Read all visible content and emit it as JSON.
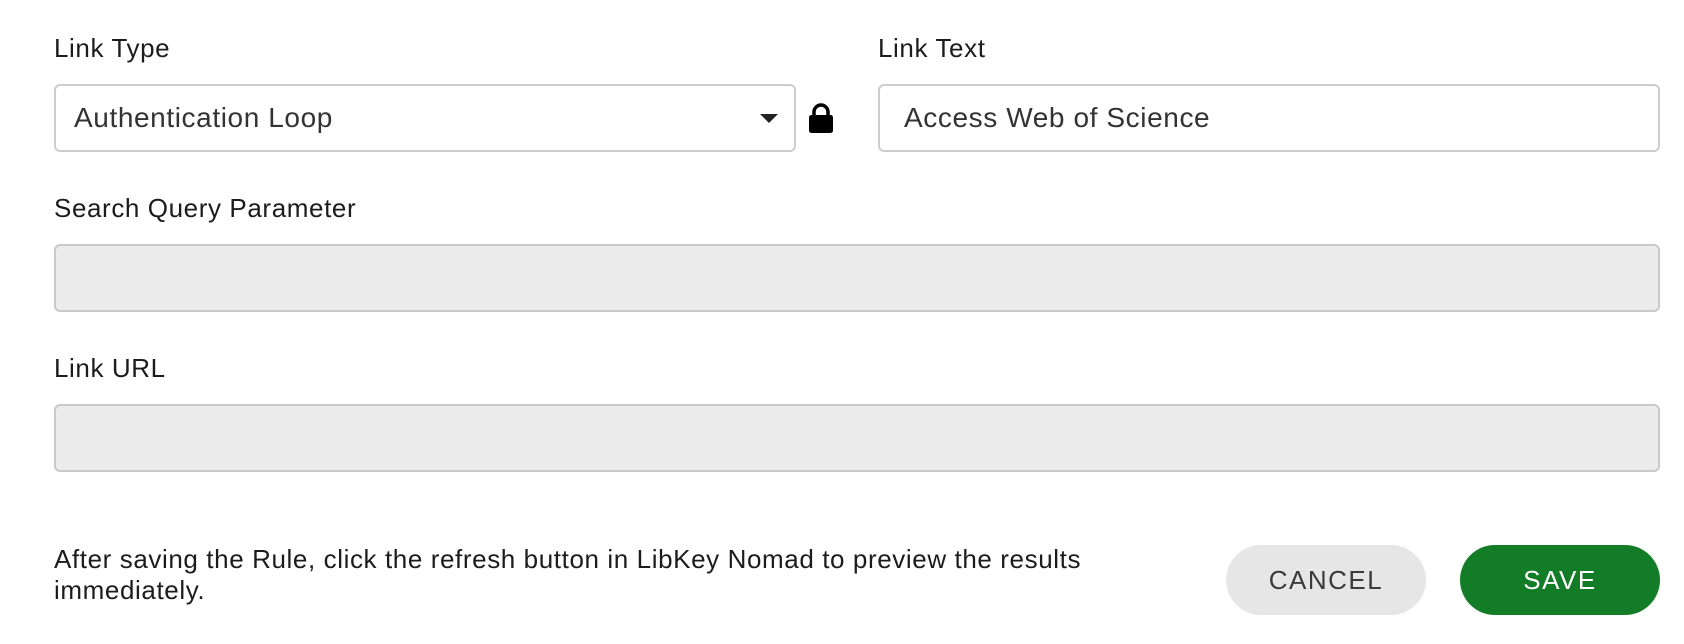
{
  "form": {
    "link_type": {
      "label": "Link Type",
      "value": "Authentication Loop",
      "locked_icon": "lock-icon",
      "dropdown_icon": "caret-down-icon"
    },
    "link_text": {
      "label": "Link Text",
      "value": "Access Web of Science"
    },
    "search_query_parameter": {
      "label": "Search Query Parameter",
      "value": "",
      "disabled": true
    },
    "link_url": {
      "label": "Link URL",
      "value": "",
      "disabled": true
    }
  },
  "footer": {
    "help_text": "After saving the Rule, click the refresh button in LibKey Nomad to preview the results immediately.",
    "cancel_label": "CANCEL",
    "save_label": "SAVE"
  },
  "colors": {
    "save_button_bg": "#137c27",
    "cancel_button_bg": "#e6e6e6",
    "disabled_field_bg": "#ececec"
  }
}
